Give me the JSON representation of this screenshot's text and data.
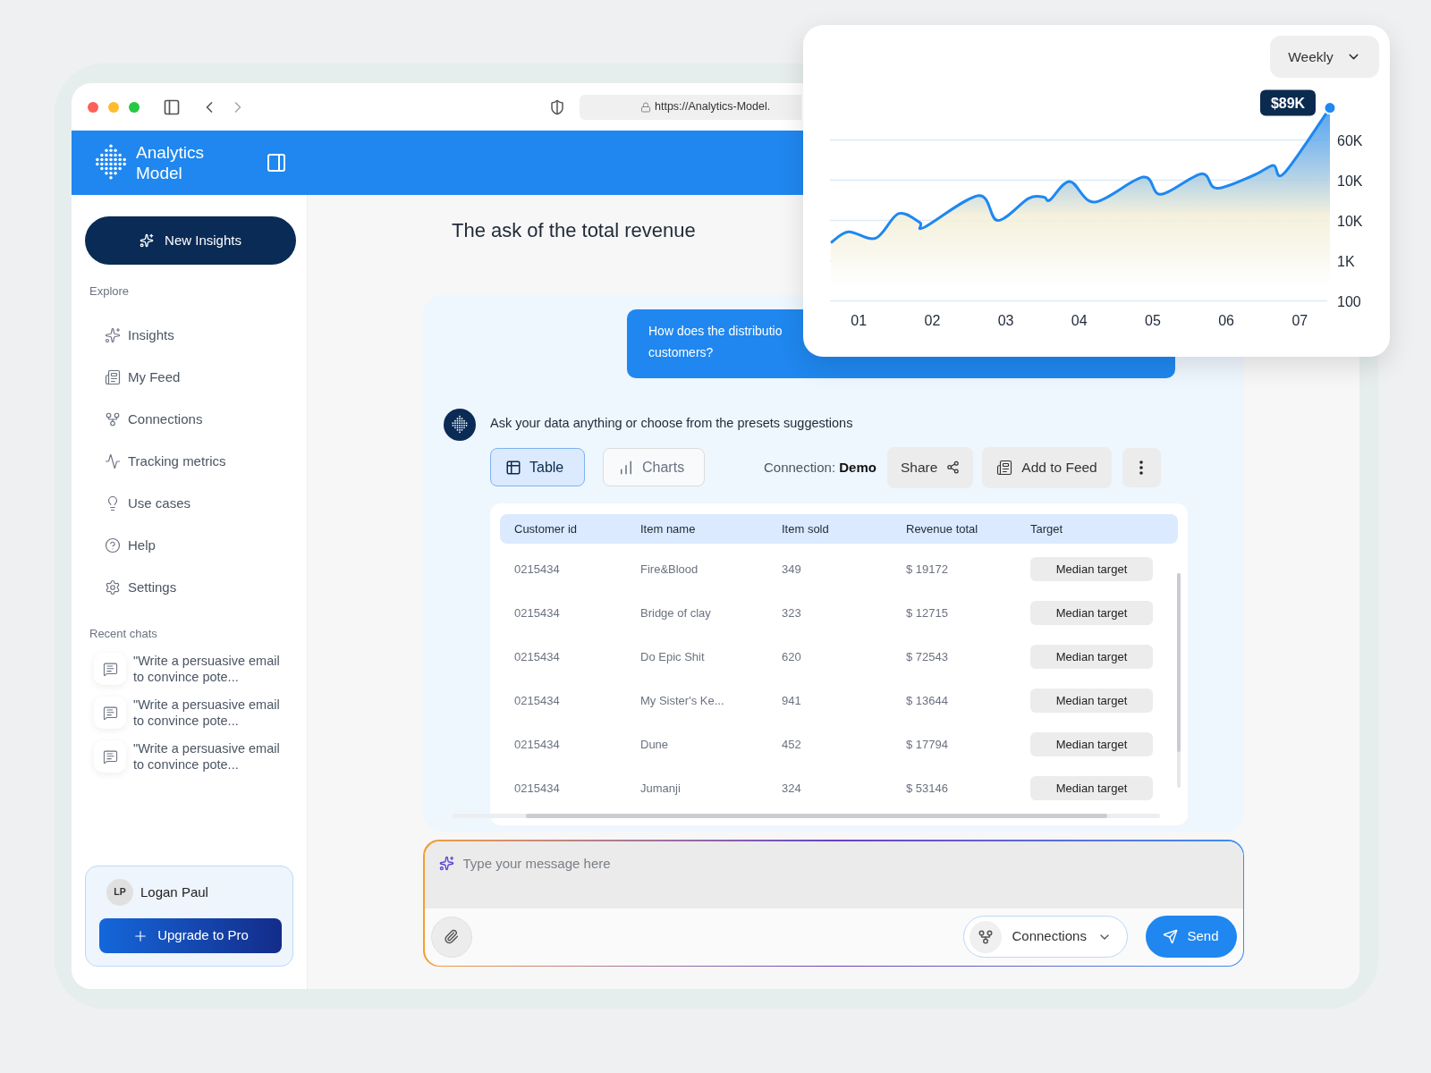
{
  "browser": {
    "url": "https://Analytics-Model."
  },
  "header": {
    "brand": "Analytics Model"
  },
  "sidebar": {
    "new_button": "New Insights",
    "explore_label": "Explore",
    "items": [
      {
        "label": "Insights"
      },
      {
        "label": "My Feed"
      },
      {
        "label": "Connections"
      },
      {
        "label": "Tracking metrics"
      },
      {
        "label": "Use cases"
      },
      {
        "label": "Help"
      },
      {
        "label": "Settings"
      }
    ],
    "recent_label": "Recent chats",
    "recent_chats": [
      "\"Write a persuasive email to convince pote...",
      "\"Write a persuasive email to convince pote...",
      "\"Write a persuasive email to convince pote..."
    ],
    "user": {
      "initials": "LP",
      "name": "Logan Paul",
      "upgrade_button": "Upgrade to Pro"
    }
  },
  "main": {
    "title": "The ask of the total revenue",
    "user_message": [
      "How does the distributio",
      "customers?"
    ],
    "assistant": {
      "prompt": "Ask your data anything or choose from the presets suggestions",
      "view_tabs": [
        {
          "label": "Table",
          "selected": true
        },
        {
          "label": "Charts",
          "selected": false
        }
      ],
      "connection": "Connection: **Demo**",
      "share_button": "Share",
      "add_button": "Add to Feed",
      "table": {
        "columns": [
          "Customer id",
          "Item name",
          "Item sold",
          "Revenue total",
          "Target"
        ],
        "rows": [
          [
            "0215434",
            "Fire&Blood",
            "349",
            "$ 19172",
            "Median target"
          ],
          [
            "0215434",
            "Bridge of clay",
            "323",
            "$ 12715",
            "Median target"
          ],
          [
            "0215434",
            "Do Epic Shit",
            "620",
            "$ 72543",
            "Median target"
          ],
          [
            "0215434",
            "My Sister's Ke...",
            "941",
            "$ 13644",
            "Median target"
          ],
          [
            "0215434",
            "Dune",
            "452",
            "$ 17794",
            "Median target"
          ],
          [
            "0215434",
            "Jumanji",
            "324",
            "$ 53146",
            "Median target"
          ]
        ]
      }
    },
    "composer": {
      "placeholder": "Type your message here",
      "connections_button": "Connections",
      "send_button": "Send"
    }
  },
  "chart_card": {
    "period_button": "Weekly",
    "x_labels": [
      "01",
      "02",
      "03",
      "04",
      "05",
      "06",
      "07"
    ],
    "y_labels": [
      "60K",
      "10K",
      "10K",
      "1K",
      "100"
    ],
    "tooltip": "$89K"
  }
}
